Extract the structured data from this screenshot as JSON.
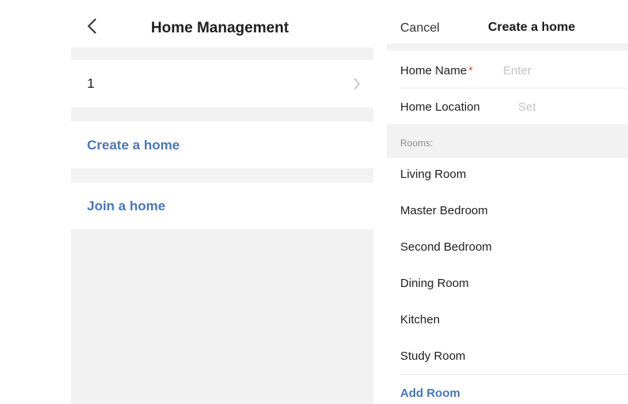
{
  "left_panel": {
    "title": "Home Management",
    "homes": [
      {
        "name": "1"
      }
    ],
    "create_label": "Create a home",
    "join_label": "Join a home"
  },
  "right_panel": {
    "cancel_label": "Cancel",
    "title": "Create a home",
    "home_name_label": "Home Name",
    "required_mark": "*",
    "home_name_placeholder": "Enter",
    "home_location_label": "Home Location",
    "home_location_placeholder": "Set",
    "rooms_label": "Rooms:",
    "rooms": [
      "Living Room",
      "Master Bedroom",
      "Second Bedroom",
      "Dining Room",
      "Kitchen",
      "Study Room"
    ],
    "add_room_label": "Add Room"
  },
  "icons": {
    "back": "chevron-left-icon",
    "row_arrow": "chevron-right-icon"
  },
  "colors": {
    "accent": "#4a77b5",
    "required": "#e84a3c",
    "background_gray": "#f2f2f2",
    "placeholder": "#c4c4c4"
  }
}
